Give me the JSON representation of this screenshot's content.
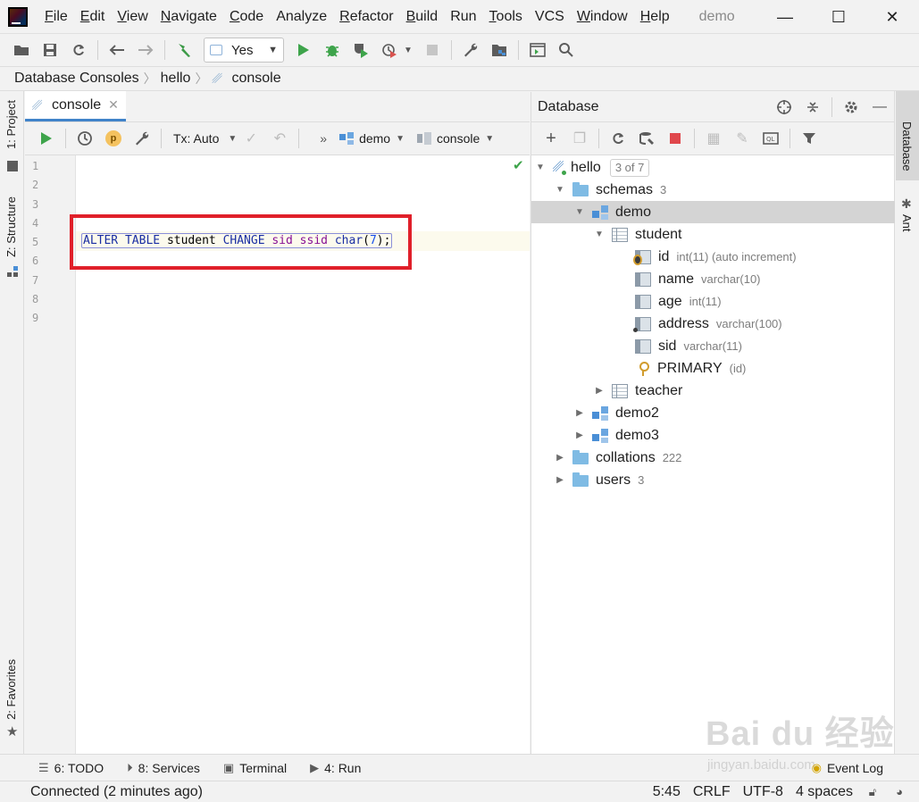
{
  "menubar": {
    "items": [
      {
        "label": "File",
        "mnemonic": "F",
        "rest": "ile"
      },
      {
        "label": "Edit",
        "mnemonic": "E",
        "rest": "dit"
      },
      {
        "label": "View",
        "mnemonic": "V",
        "rest": "iew"
      },
      {
        "label": "Navigate",
        "mnemonic": "N",
        "rest": "avigate"
      },
      {
        "label": "Code",
        "mnemonic": "C",
        "rest": "ode"
      },
      {
        "label": "Analyze",
        "mnemonic": "",
        "rest": "Analyze"
      },
      {
        "label": "Refactor",
        "mnemonic": "R",
        "rest": "efactor"
      },
      {
        "label": "Build",
        "mnemonic": "B",
        "rest": "uild"
      },
      {
        "label": "Run",
        "mnemonic": "",
        "rest": "Run"
      },
      {
        "label": "Tools",
        "mnemonic": "T",
        "rest": "ools"
      },
      {
        "label": "VCS",
        "mnemonic": "",
        "rest": "VCS"
      },
      {
        "label": "Window",
        "mnemonic": "W",
        "rest": "indow"
      },
      {
        "label": "Help",
        "mnemonic": "H",
        "rest": "elp"
      }
    ],
    "window_title": "demo",
    "minimize": "—",
    "maximize": "☐",
    "close": "✕"
  },
  "toolbar": {
    "run_config": "Yes"
  },
  "breadcrumbs": [
    "Database Consoles",
    "hello",
    "console"
  ],
  "left_strip": {
    "project": "1: Project",
    "structure": "Z: Structure",
    "favorites": "2: Favorites"
  },
  "right_strip": {
    "database": "Database",
    "ant": "Ant"
  },
  "editor": {
    "tab_label": "console",
    "tx_mode": "Tx: Auto",
    "datasource": "demo",
    "session": "console",
    "line_numbers": [
      "1",
      "2",
      "3",
      "4",
      "5",
      "6",
      "7",
      "8",
      "9"
    ],
    "code": {
      "alter": "ALTER",
      "table": "TABLE",
      "student": "student",
      "change": "CHANGE",
      "sid": "sid",
      "ssid": "ssid",
      "char": "char",
      "open": "(",
      "num": "7",
      "close": ");"
    }
  },
  "database_panel": {
    "title": "Database",
    "tree": {
      "hello": "hello",
      "hello_badge": "3 of 7",
      "schemas": "schemas",
      "schemas_count": "3",
      "demo": "demo",
      "student": "student",
      "columns": [
        {
          "name": "id",
          "type": "int(11) (auto increment)"
        },
        {
          "name": "name",
          "type": "varchar(10)"
        },
        {
          "name": "age",
          "type": "int(11)"
        },
        {
          "name": "address",
          "type": "varchar(100)"
        },
        {
          "name": "sid",
          "type": "varchar(11)"
        }
      ],
      "primary": "PRIMARY",
      "primary_cols": "(id)",
      "teacher": "teacher",
      "demo2": "demo2",
      "demo3": "demo3",
      "collations": "collations",
      "collations_count": "222",
      "users": "users",
      "users_count": "3"
    }
  },
  "bottom_tools": {
    "todo": "6: TODO",
    "services": "8: Services",
    "terminal": "Terminal",
    "run": "4: Run",
    "event_log": "Event Log"
  },
  "status": {
    "message": "Connected (2 minutes ago)",
    "position": "5:45",
    "line_sep": "CRLF",
    "encoding": "UTF-8",
    "indent": "4 spaces"
  },
  "watermark": {
    "main": "Bai du 经验",
    "sub": "jingyan.baidu.com"
  }
}
